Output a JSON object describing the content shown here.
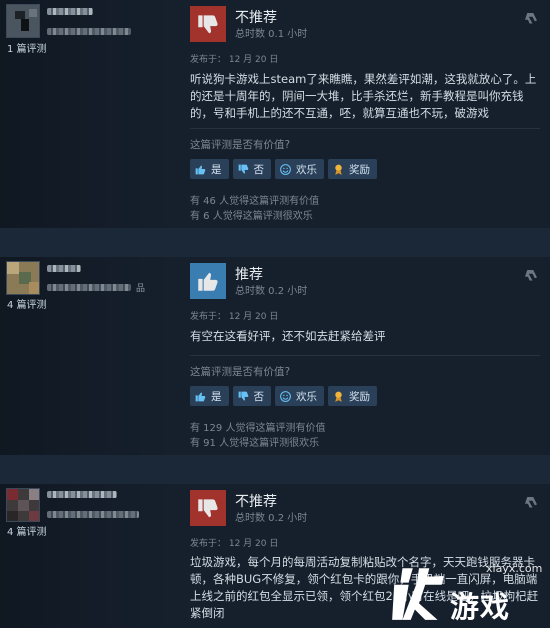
{
  "reviews": [
    {
      "author_name": "(blurred)",
      "review_count": "1 篇评测",
      "verdict": "不推荐",
      "recommended": false,
      "hours": "总时数 0.1 小时",
      "posted": "发布于：  12 月 20 日",
      "text": "听说狗卡游戏上steam了来瞧瞧，果然差评如潮，这我就放心了。上的还是十周年的，阴间一大堆，比手杀还烂，新手教程是叫你充钱的，号和手机上的还不互通，呸，就算互通也不玩，破游戏",
      "helpful_question": "这篇评测是否有价值?",
      "buttons": {
        "yes": "是",
        "no": "否",
        "funny": "欢乐",
        "award": "奖励"
      },
      "helpful_count": "有 46 人觉得这篇评测有价值",
      "funny_count": "有 6 人觉得这篇评测很欢乐"
    },
    {
      "author_name": "(blurred)",
      "review_count": "4 篇评测",
      "extra": "品",
      "verdict": "推荐",
      "recommended": true,
      "hours": "总时数 0.2 小时",
      "posted": "发布于：  12 月 20 日",
      "text": "有空在这看好评，还不如去赶紧给差评",
      "helpful_question": "这篇评测是否有价值?",
      "buttons": {
        "yes": "是",
        "no": "否",
        "funny": "欢乐",
        "award": "奖励"
      },
      "helpful_count": "有 129 人觉得这篇评测有价值",
      "funny_count": "有 91 人觉得这篇评测很欢乐"
    },
    {
      "author_name": "(blurred)",
      "review_count": "4 篇评测",
      "verdict": "不推荐",
      "recommended": false,
      "hours": "总时数 0.2 小时",
      "posted": "发布于：  12 月 20 日",
      "text": "垃圾游戏，每个月的每周活动复制粘贴改个名字，天天跑钱服务器卡顿，各种BUG不修复，领个红包卡的跟你，手机端一直闪屏，电脑端上线之前的红包全显示已领，领个红包24小时在线是吧，垃圾枸杞赶紧倒闭"
    }
  ],
  "watermark": {
    "url": "xiayx.com",
    "text": "游戏"
  },
  "colors": {
    "background": "#1b2838",
    "panel": "#16202d",
    "thumb_down": "#a1322c",
    "thumb_up": "#3a7db0",
    "button": "#2a3f58"
  }
}
